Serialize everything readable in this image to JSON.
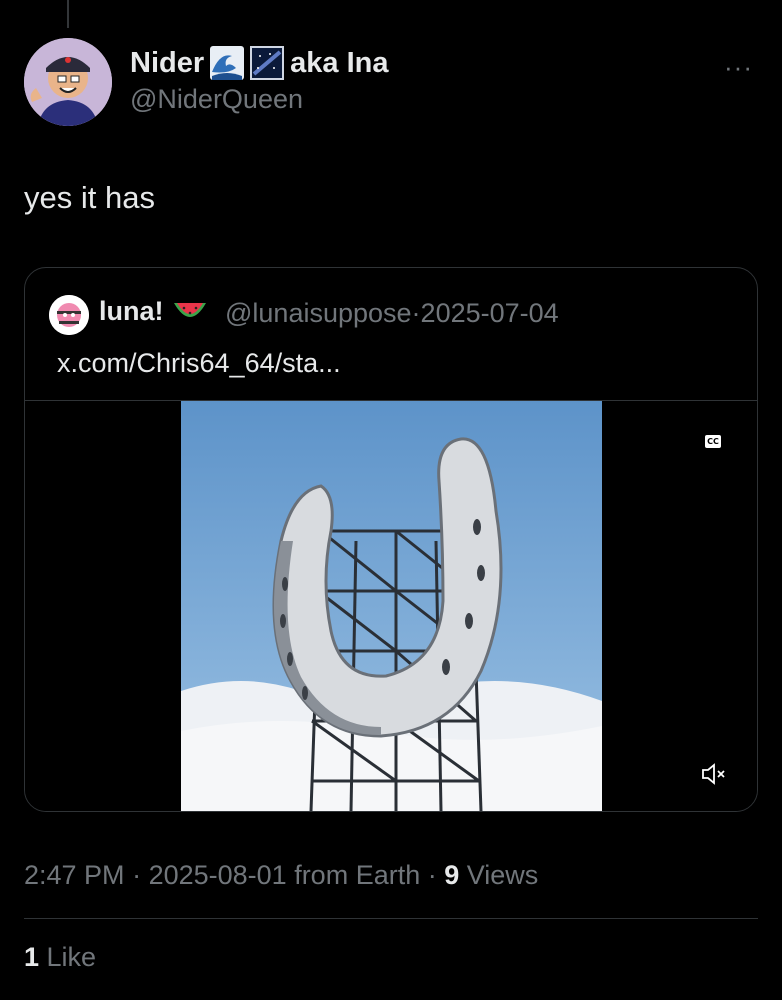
{
  "author": {
    "display_name": "Nider",
    "emojis": [
      "water-wave-emoji",
      "milky-way-emoji"
    ],
    "name_suffix": "aka Ina",
    "handle": "@NiderQueen"
  },
  "post": {
    "text": "yes it has",
    "more_label": "···"
  },
  "quoted": {
    "display_name": "luna!",
    "emoji": "watermelon-emoji",
    "handle": "@lunaisuppose",
    "separator": "·",
    "date": "2025-07-04",
    "text": "x.com/Chris64_64/sta...",
    "cc_label": "CC"
  },
  "meta": {
    "time": "2:47 PM",
    "sep1": " · ",
    "date": "2025-08-01",
    "location": " from Earth",
    "sep2": " · ",
    "views_count": "9",
    "views_label": " Views"
  },
  "likes": {
    "count": "1",
    "label": " Like"
  },
  "colors": {
    "background": "#000000",
    "text_primary": "#e7e9ea",
    "text_secondary": "#71767b",
    "border": "#2f3336"
  }
}
